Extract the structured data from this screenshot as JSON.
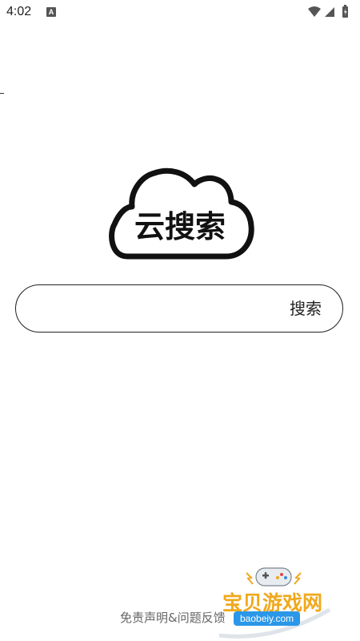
{
  "status_bar": {
    "time": "4:02",
    "notification_icon": "a-icon",
    "icons": [
      "wifi-icon",
      "signal-icon",
      "battery-icon"
    ]
  },
  "logo": {
    "text": "云搜索",
    "icon": "cloud-logo"
  },
  "search": {
    "placeholder": "",
    "value": "",
    "button_label": "搜索"
  },
  "footer": {
    "link_text": "免责声明&问题反馈"
  },
  "watermark": {
    "title": "宝贝游戏网",
    "subtitle": "baobeiy.com"
  },
  "colors": {
    "background": "#ffffff",
    "text": "#222222",
    "footer_text": "#666666",
    "watermark_orange": "#f0a81c",
    "watermark_blue": "#2a97e8"
  }
}
